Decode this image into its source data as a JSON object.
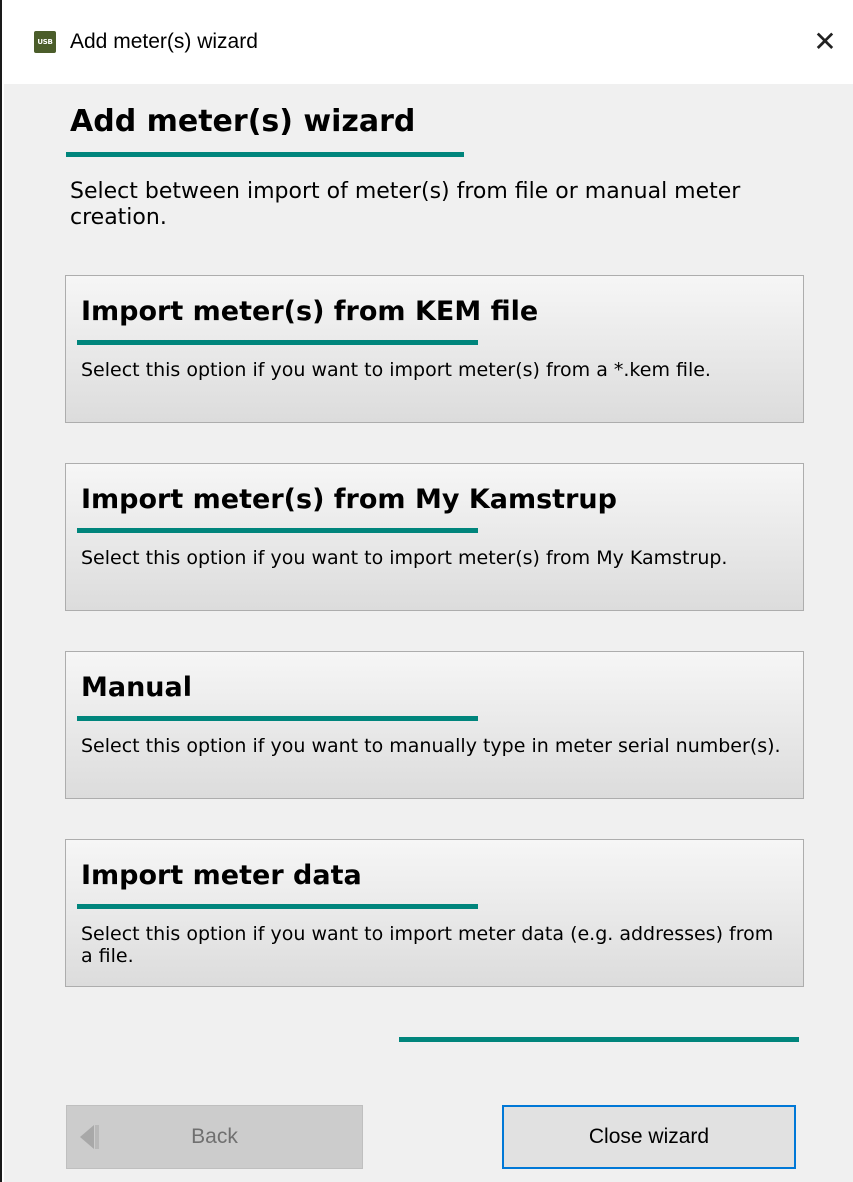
{
  "window": {
    "icon_text": "USB",
    "title": "Add meter(s) wizard",
    "close_glyph": "✕"
  },
  "wizard": {
    "heading": "Add meter(s) wizard",
    "intro": "Select between import of meter(s) from file or manual meter creation.",
    "accent_color": "#00857c"
  },
  "options": [
    {
      "title": "Import meter(s) from KEM file",
      "description": "Select this option if you want to import meter(s) from a *.kem file."
    },
    {
      "title": "Import meter(s) from My Kamstrup",
      "description": "Select this option if you want to import meter(s) from My Kamstrup."
    },
    {
      "title": "Manual",
      "description": "Select this option if you want to manually type in meter serial number(s)."
    },
    {
      "title": "Import meter data",
      "description": "Select this option if you want to import meter data (e.g. addresses) from a file."
    }
  ],
  "footer": {
    "back_label": "Back",
    "back_icon": "back-arrow-icon",
    "back_enabled": false,
    "close_label": "Close wizard",
    "focus_color": "#0078d7"
  }
}
